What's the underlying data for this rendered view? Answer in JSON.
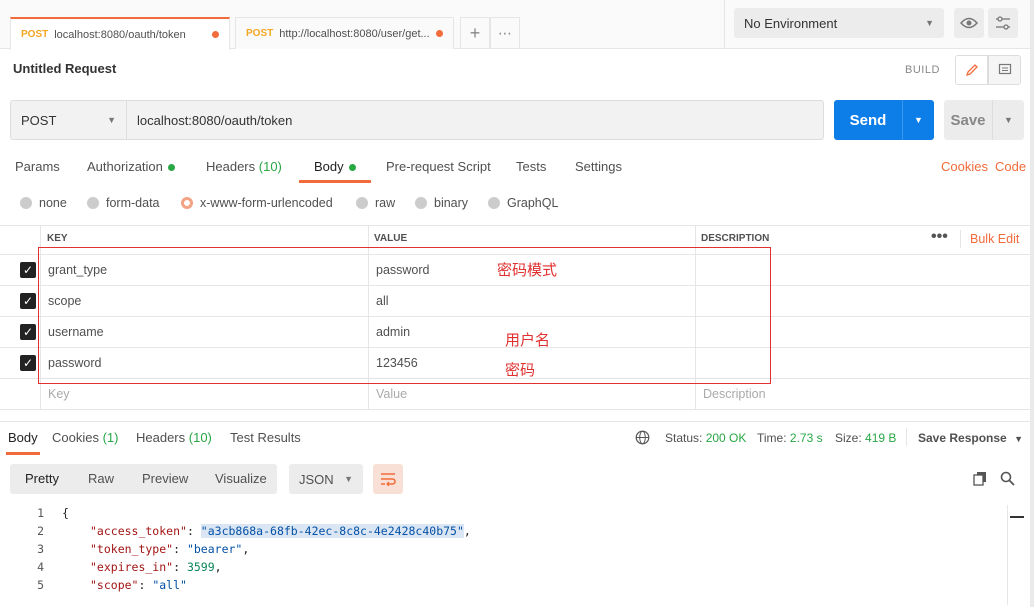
{
  "tabs": [
    {
      "method": "POST",
      "url": "localhost:8080/oauth/token"
    },
    {
      "method": "POST",
      "url": "http://localhost:8080/user/get..."
    }
  ],
  "environment": "No Environment",
  "request": {
    "title": "Untitled Request",
    "build_label": "BUILD",
    "method": "POST",
    "url": "localhost:8080/oauth/token",
    "send_label": "Send",
    "save_label": "Save"
  },
  "req_tabs": {
    "params": "Params",
    "authorization": "Authorization",
    "headers": "Headers",
    "headers_count": "(10)",
    "body": "Body",
    "prerequest": "Pre-request Script",
    "tests": "Tests",
    "settings": "Settings",
    "cookies": "Cookies",
    "code": "Code"
  },
  "body_types": [
    "none",
    "form-data",
    "x-www-form-urlencoded",
    "raw",
    "binary",
    "GraphQL"
  ],
  "selected_body_type": "x-www-form-urlencoded",
  "table": {
    "headers": {
      "key": "KEY",
      "value": "VALUE",
      "description": "DESCRIPTION"
    },
    "bulk_edit": "Bulk Edit",
    "rows": [
      {
        "key": "grant_type",
        "value": "password",
        "checked": true
      },
      {
        "key": "scope",
        "value": "all",
        "checked": true
      },
      {
        "key": "username",
        "value": "admin",
        "checked": true
      },
      {
        "key": "password",
        "value": "123456",
        "checked": true
      }
    ],
    "placeholders": {
      "key": "Key",
      "value": "Value",
      "description": "Description"
    }
  },
  "annotations": {
    "password_mode": "密码模式",
    "username": "用户名",
    "password": "密码"
  },
  "response": {
    "tabs": {
      "body": "Body",
      "cookies": "Cookies",
      "cookies_count": "(1)",
      "headers": "Headers",
      "headers_count": "(10)",
      "test_results": "Test Results"
    },
    "status_label": "Status:",
    "status_value": "200 OK",
    "time_label": "Time:",
    "time_value": "2.73 s",
    "size_label": "Size:",
    "size_value": "419 B",
    "save_response": "Save Response",
    "view_modes": [
      "Pretty",
      "Raw",
      "Preview",
      "Visualize"
    ],
    "format": "JSON",
    "code_lines": [
      {
        "n": "1",
        "text": "{"
      },
      {
        "n": "2",
        "key": "\"access_token\"",
        "value": "\"a3cb868a-68fb-42ec-8c8c-4e2428c40b75\"",
        "type": "string",
        "highlight": true
      },
      {
        "n": "3",
        "key": "\"token_type\"",
        "value": "\"bearer\"",
        "type": "string"
      },
      {
        "n": "4",
        "key": "\"expires_in\"",
        "value": "3599",
        "type": "number"
      },
      {
        "n": "5",
        "key": "\"scope\"",
        "value": "\"all\"",
        "type": "string"
      }
    ]
  },
  "colors": {
    "accent": "#f26b3a",
    "send": "#0d7ee8",
    "status_green": "#28a745",
    "annotation_red": "#e03030"
  }
}
